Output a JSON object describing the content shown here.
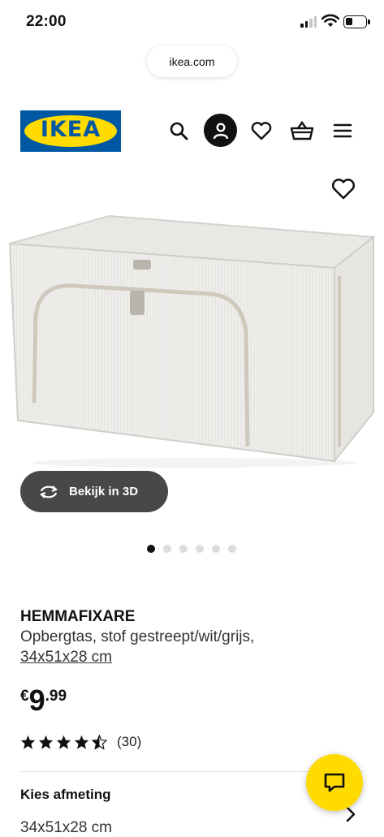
{
  "status_bar": {
    "time": "22:00"
  },
  "browser": {
    "url": "ikea.com"
  },
  "header": {
    "logo_text": "IKEA",
    "icons": [
      "search-icon",
      "account-icon",
      "heart-icon",
      "basket-icon",
      "menu-icon"
    ]
  },
  "gallery": {
    "view_3d_label": "Bekijk in 3D",
    "slide_count": 6,
    "active_slide": 1
  },
  "product": {
    "name": "HEMMAFIXARE",
    "description": "Opbergtas, stof gestreept/wit/grijs,",
    "size": "34x51x28 cm",
    "price_currency": "€",
    "price_integer": "9",
    "price_decimal": ".99",
    "rating_stars": 4.5,
    "review_count": "(30)"
  },
  "size_section": {
    "label": "Kies afmeting",
    "selected": "34x51x28 cm"
  },
  "colors": {
    "ikea_blue": "#0058a3",
    "ikea_yellow": "#ffdb00"
  }
}
